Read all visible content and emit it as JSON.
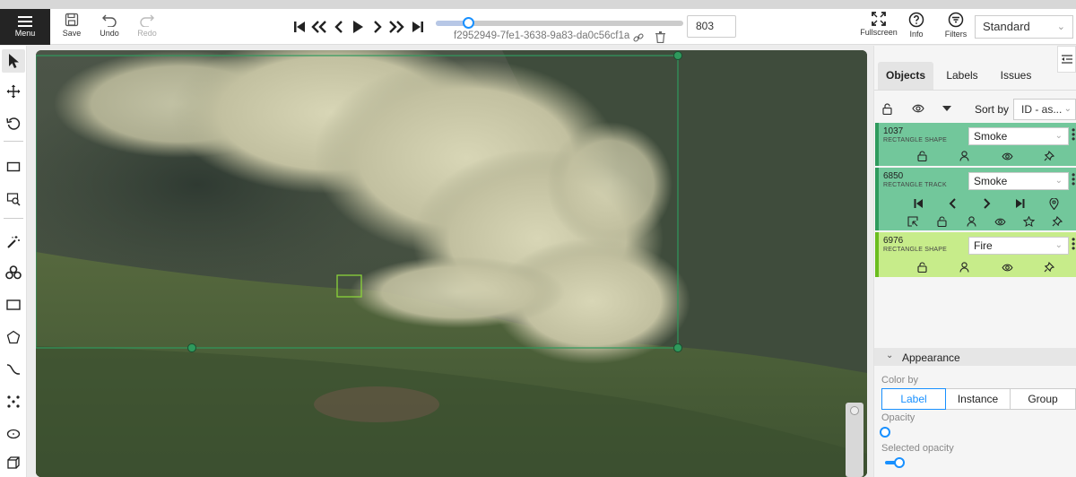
{
  "toolbar": {
    "menu_label": "Menu",
    "save_label": "Save",
    "undo_label": "Undo",
    "redo_label": "Redo",
    "job_id": "f2952949-7fe1-3638-9a83-da0c56cf1a",
    "frame_number": "803",
    "fullscreen_label": "Fullscreen",
    "info_label": "Info",
    "filters_label": "Filters",
    "workspace_mode": "Standard",
    "frame_progress": 0.13
  },
  "panel": {
    "tabs": [
      "Objects",
      "Labels",
      "Issues"
    ],
    "active_tab": "Objects",
    "sort_label": "Sort by",
    "sort_value": "ID - as..."
  },
  "objects": [
    {
      "id": "1037",
      "type": "RECTANGLE SHAPE",
      "label": "Smoke",
      "color": "#2f9a5d"
    },
    {
      "id": "6850",
      "type": "RECTANGLE TRACK",
      "label": "Smoke",
      "color": "#2f9a5d"
    },
    {
      "id": "6976",
      "type": "RECTANGLE SHAPE",
      "label": "Fire",
      "color": "#6bbd1f"
    }
  ],
  "appearance": {
    "title": "Appearance",
    "color_by_label": "Color by",
    "color_by_options": [
      "Label",
      "Instance",
      "Group"
    ],
    "color_by_selected": "Label",
    "opacity_label": "Opacity",
    "opacity_value": 0,
    "selected_opacity_label": "Selected opacity",
    "selected_opacity_value": 0.04
  },
  "colors": {
    "accent": "#1890ff",
    "smoke_box": "#2f9a5d",
    "fire_box": "#8bd33a",
    "menu_bg": "#242424"
  }
}
